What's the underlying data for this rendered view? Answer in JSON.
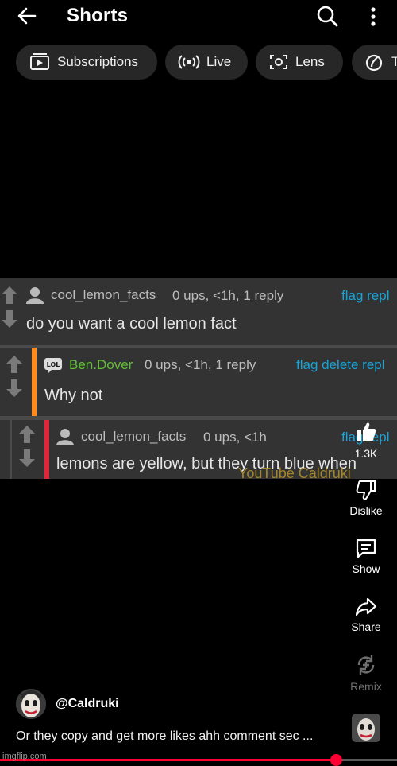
{
  "header": {
    "title": "Shorts",
    "back_icon": "arrow-left-icon",
    "search_icon": "search-icon",
    "more_icon": "more-vertical-icon"
  },
  "chips": [
    {
      "label": "Subscriptions",
      "icon": "subscriptions-icon"
    },
    {
      "label": "Live",
      "icon": "live-icon"
    },
    {
      "label": "Lens",
      "icon": "lens-icon"
    },
    {
      "label": "T",
      "icon": "trending-icon"
    }
  ],
  "video": {
    "comments": [
      {
        "user": "cool_lemon_facts",
        "meta": "0 ups, <1h, 1 reply",
        "links": "flag repl",
        "text": "do you want a cool lemon fact"
      },
      {
        "user": "Ben.Dover",
        "meta": "0 ups, <1h, 1 reply",
        "links": "flag delete repl",
        "text": "Why not",
        "badge": "LOL"
      },
      {
        "user": "cool_lemon_facts",
        "meta": "0 ups, <1h",
        "links": "flag repl",
        "text": "lemons are yellow, but they turn blue when"
      }
    ],
    "watermark": "YouTube Caldruki",
    "accent_orange": "#ff8c1a",
    "accent_red": "#e0263a",
    "link_color": "#1aa3d6"
  },
  "actions": {
    "like_count": "1.3K",
    "dislike_label": "Dislike",
    "comments_label": "Show",
    "share_label": "Share",
    "remix_label": "Remix"
  },
  "channel": {
    "handle": "@Caldruki",
    "caption": "Or they copy and get more likes ahh comment sec ..."
  },
  "progress": {
    "fraction": 0.845,
    "color": "#ff0033"
  },
  "watermark_site": "imgflip.com"
}
